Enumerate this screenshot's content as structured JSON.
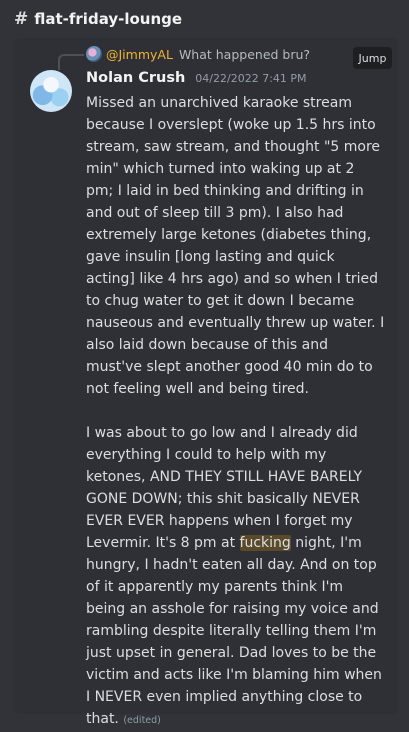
{
  "channel": {
    "hash": "#",
    "name": "flat-friday-lounge"
  },
  "reply": {
    "author": "@JimmyAL",
    "text": "What happened bru?",
    "jump_label": "Jump"
  },
  "message": {
    "author": "Nolan Crush",
    "timestamp": "04/22/2022 7:41 PM",
    "para1": "Missed an unarchived karaoke stream because I overslept (woke up 1.5 hrs into stream, saw stream, and thought \"5 more min\" which turned into waking up at 2 pm; I laid in bed thinking and drifting in and out of sleep till 3 pm). I also had extremely large ketones (diabetes thing, gave insulin [long lasting and quick acting] like 4 hrs ago) and so when I tried to chug water to get it down I became nauseous and eventually threw up water. I also laid down because of this and must've slept another good 40 min do to not feeling well and being tired.",
    "para2_before": "I was about to go low and I already did everything I could to help with my ketones, AND THEY STILL HAVE BARELY GONE DOWN; this shit basically NEVER EVER EVER happens when I forget my Levermir. It's 8 pm at ",
    "para2_highlight": "fucking",
    "para2_after": " night, I'm hungry, I hadn't eaten all day. And on top of it apparently my parents think I'm being an asshole for raising my voice and rambling despite literally telling them I'm just upset in general. Dad loves to be the victim and acts like I'm blaming him when I NEVER even implied anything close to that.",
    "edited_label": "(edited)"
  }
}
